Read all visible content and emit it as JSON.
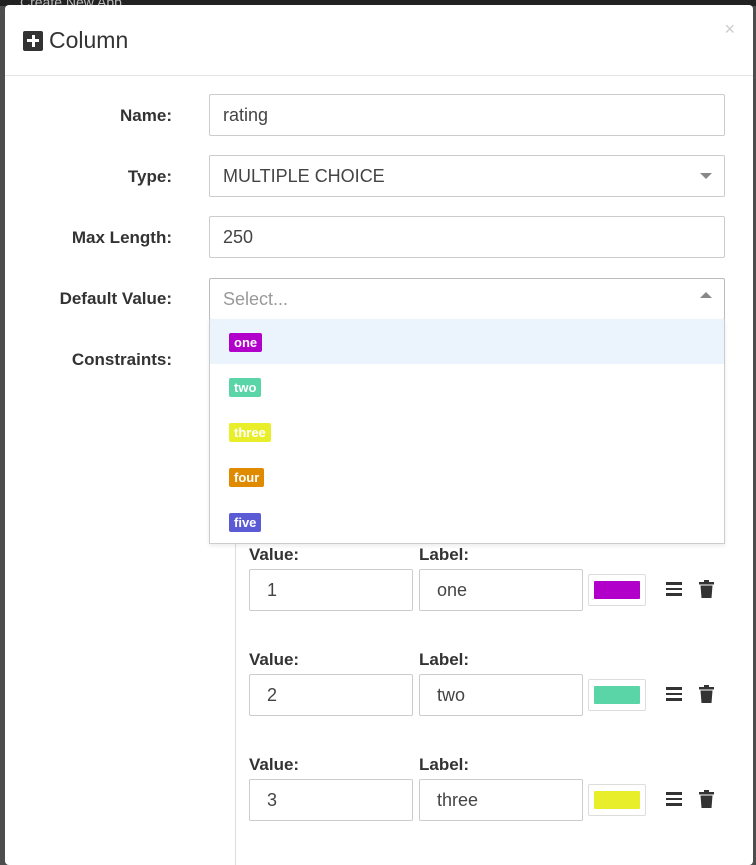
{
  "backdrop": {
    "text": "Create New App"
  },
  "modal": {
    "title": "Column",
    "close_symbol": "×"
  },
  "form": {
    "name": {
      "label": "Name:",
      "value": "rating"
    },
    "type": {
      "label": "Type:",
      "value": "MULTIPLE CHOICE"
    },
    "max_length": {
      "label": "Max Length:",
      "value": "250"
    },
    "default_value": {
      "label": "Default Value:",
      "placeholder": "Select..."
    },
    "constraints": {
      "label": "Constraints:"
    }
  },
  "dropdown_options": [
    {
      "label": "one",
      "color": "#b100c9",
      "highlighted": true
    },
    {
      "label": "two",
      "color": "#5ad5a8"
    },
    {
      "label": "three",
      "color": "#e9ee2b"
    },
    {
      "label": "four",
      "color": "#e08a00"
    },
    {
      "label": "five",
      "color": "#5b5bd6"
    }
  ],
  "constraint_rows": [
    {
      "value_label": "Value:",
      "label_label": "Label:",
      "value": "1",
      "label": "one",
      "color": "#b100c9"
    },
    {
      "value_label": "Value:",
      "label_label": "Label:",
      "value": "2",
      "label": "two",
      "color": "#5ad5a8"
    },
    {
      "value_label": "Value:",
      "label_label": "Label:",
      "value": "3",
      "label": "three",
      "color": "#e9ee2b"
    }
  ]
}
